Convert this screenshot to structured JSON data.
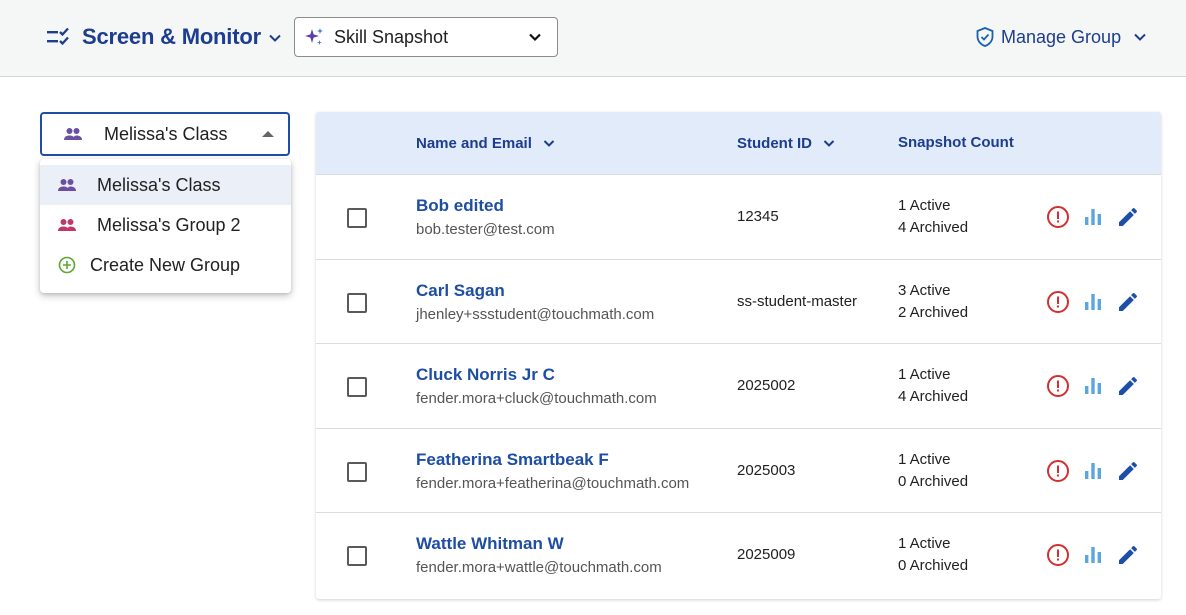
{
  "header": {
    "app_title": "Screen & Monitor",
    "assessment_select": "Skill Snapshot",
    "manage_group_label": "Manage Group"
  },
  "group_dropdown": {
    "selected": "Melissa's Class",
    "options": [
      {
        "label": "Melissa's Class",
        "icon": "people-icon",
        "color": "#6a4fa3",
        "selected": true
      },
      {
        "label": "Melissa's Group 2",
        "icon": "people-icon",
        "color": "#c0386b",
        "selected": false
      },
      {
        "label": "Create New Group",
        "icon": "plus-circle-icon",
        "color": "#5aa832",
        "selected": false
      }
    ]
  },
  "table": {
    "columns": {
      "name": "Name and Email",
      "student_id": "Student ID",
      "snapshot_count": "Snapshot Count"
    },
    "rows": [
      {
        "name": "Bob edited",
        "email": "bob.tester@test.com",
        "student_id": "12345",
        "active": "1 Active",
        "archived": "4 Archived"
      },
      {
        "name": "Carl Sagan",
        "email": "jhenley+ssstudent@touchmath.com",
        "student_id": "ss-student-master",
        "active": "3 Active",
        "archived": "2 Archived"
      },
      {
        "name": "Cluck Norris Jr C",
        "email": "fender.mora+cluck@touchmath.com",
        "student_id": "2025002",
        "active": "1 Active",
        "archived": "4 Archived"
      },
      {
        "name": "Featherina Smartbeak F",
        "email": "fender.mora+featherina@touchmath.com",
        "student_id": "2025003",
        "active": "1 Active",
        "archived": "0 Archived"
      },
      {
        "name": "Wattle Whitman W",
        "email": "fender.mora+wattle@touchmath.com",
        "student_id": "2025009",
        "active": "1 Active",
        "archived": "0 Archived"
      }
    ]
  },
  "colors": {
    "brand_blue": "#1d3d8f",
    "link_blue": "#1e4ea3",
    "header_bg": "#e2ebf9",
    "alert_red": "#d32f2f",
    "chart_blue": "#5aa6e0"
  }
}
